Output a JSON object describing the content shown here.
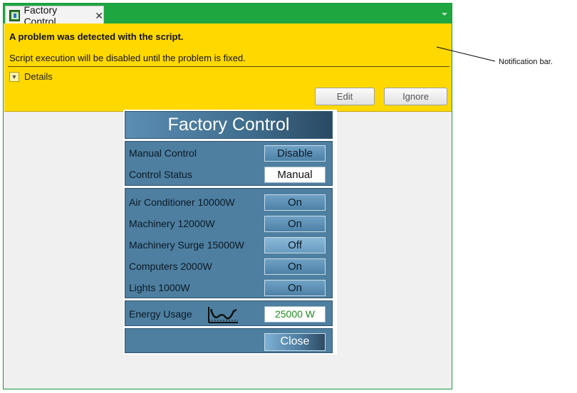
{
  "window": {
    "tab_title": "Factory Control",
    "tab_close": "✕"
  },
  "notification": {
    "title": "A problem was detected with the script.",
    "message": "Script execution will be disabled until the problem is fixed.",
    "details_label": "Details",
    "edit_label": "Edit",
    "ignore_label": "Ignore"
  },
  "panel": {
    "title": "Factory Control",
    "manual_control_label": "Manual Control",
    "manual_control_button": "Disable",
    "control_status_label": "Control Status",
    "control_status_value": "Manual",
    "devices": [
      {
        "label": "Air Conditioner 10000W",
        "state": "On"
      },
      {
        "label": "Machinery 12000W",
        "state": "On"
      },
      {
        "label": "Machinery Surge 15000W",
        "state": "Off"
      },
      {
        "label": "Computers 2000W",
        "state": "On"
      },
      {
        "label": "Lights 1000W",
        "state": "On"
      }
    ],
    "energy_label": "Energy Usage",
    "energy_value": "25000 W",
    "close_label": "Close"
  },
  "callout": {
    "text": "Notification bar."
  },
  "colors": {
    "window_green": "#1ea640",
    "notification_yellow": "#ffd800",
    "panel_blue": "#4e7fa0",
    "energy_value_green": "#1f8a1f"
  }
}
